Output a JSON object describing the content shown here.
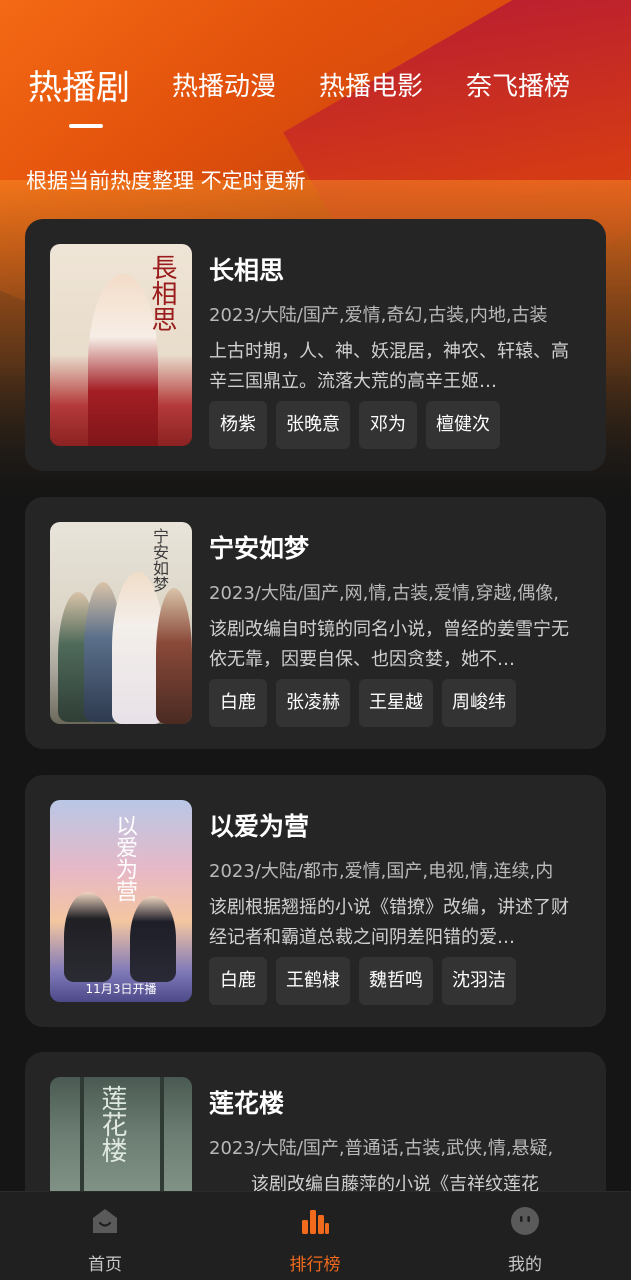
{
  "top_tabs": [
    {
      "label": "热播剧",
      "active": true
    },
    {
      "label": "热播动漫",
      "active": false
    },
    {
      "label": "热播电影",
      "active": false
    },
    {
      "label": "奈飞播榜",
      "active": false
    }
  ],
  "subtitle": "根据当前热度整理 不定时更新",
  "cards": [
    {
      "title": "长相思",
      "meta": "2023/大陆/国产,爱情,奇幻,古装,内地,古装",
      "description": "上古时期，人、神、妖混居，神农、轩辕、高辛三国鼎立。流落大荒的高辛王姬…",
      "actors": [
        "杨紫",
        "张晚意",
        "邓为",
        "檀健次"
      ],
      "poster_text": "長相思"
    },
    {
      "title": "宁安如梦",
      "meta": "2023/大陆/国产,网,情,古装,爱情,穿越,偶像,",
      "description": "该剧改编自时镜的同名小说，曾经的姜雪宁无依无靠，因要自保、也因贪婪，她不…",
      "actors": [
        "白鹿",
        "张凌赫",
        "王星越",
        "周峻纬"
      ],
      "poster_text": "宁安如梦"
    },
    {
      "title": "以爱为营",
      "meta": "2023/大陆/都市,爱情,国产,电视,情,连续,内",
      "description": "该剧根据翘摇的小说《错撩》改编，讲述了财经记者和霸道总裁之间阴差阳错的爱…",
      "actors": [
        "白鹿",
        "王鹤棣",
        "魏哲鸣",
        "沈羽洁"
      ],
      "poster_text": "以爱为营",
      "poster_caption": "11月3日开播"
    },
    {
      "title": "莲花楼",
      "meta": "2023/大陆/国产,普通话,古装,武侠,情,悬疑,",
      "description": "该剧改编自藤萍的小说《吉祥纹莲花",
      "actors": [],
      "poster_text": "莲花楼"
    }
  ],
  "bottom_nav": [
    {
      "label": "首页",
      "icon": "home-icon",
      "active": false
    },
    {
      "label": "排行榜",
      "icon": "ranking-icon",
      "active": true
    },
    {
      "label": "我的",
      "icon": "profile-icon",
      "active": false
    }
  ],
  "colors": {
    "accent": "#f26a1b",
    "card_bg": "#252525",
    "page_bg": "#151515",
    "chip_bg": "#333333"
  }
}
